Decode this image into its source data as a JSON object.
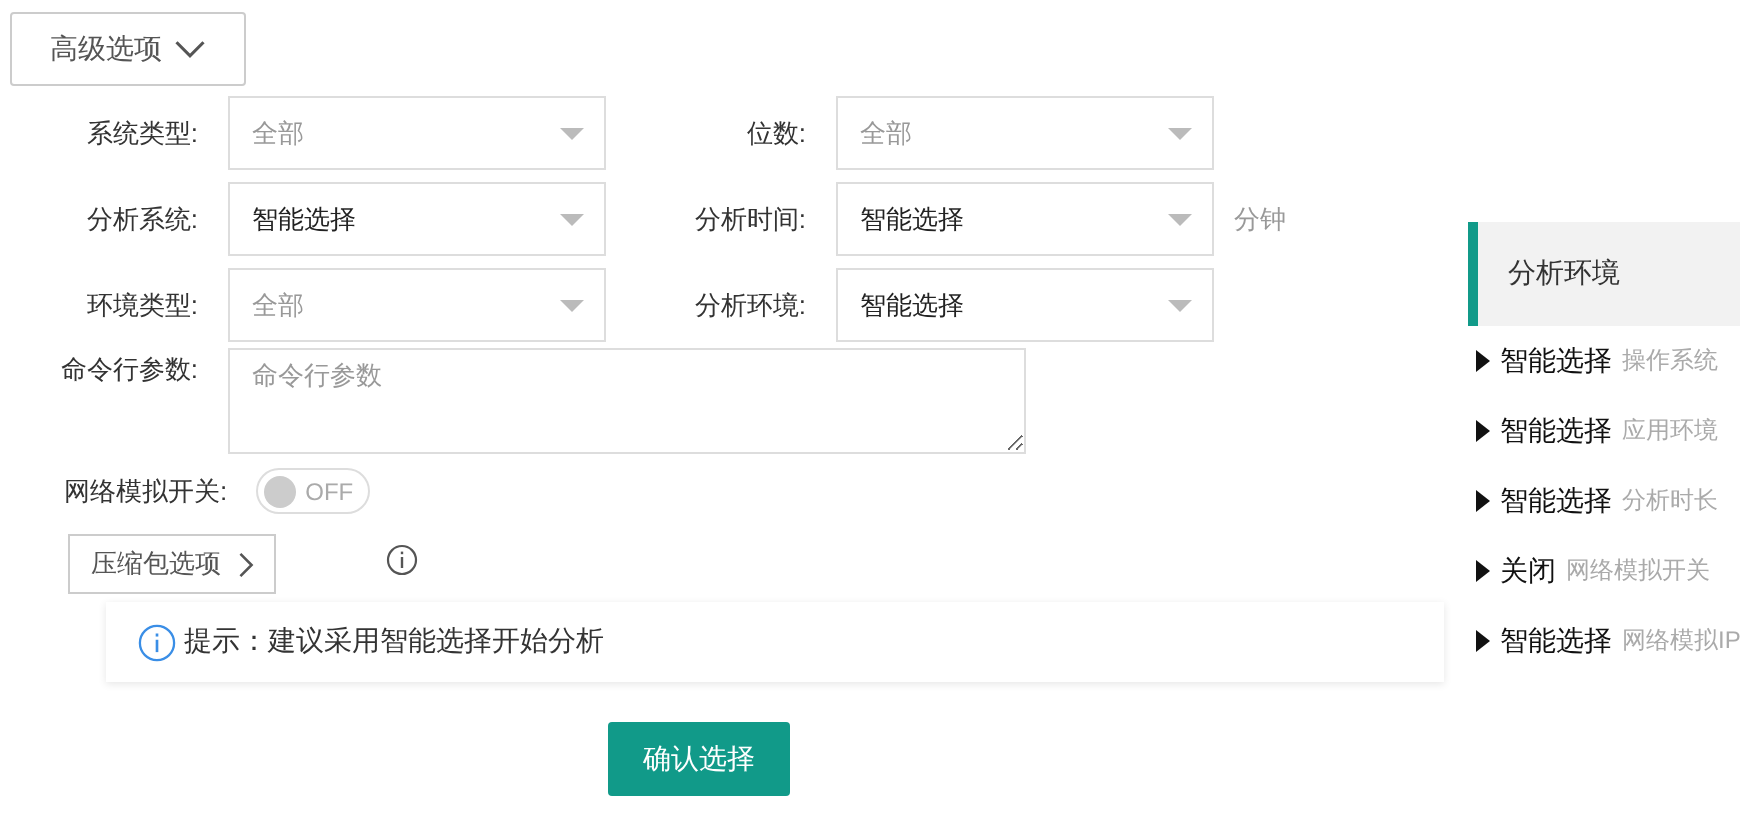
{
  "advanced_toggle": {
    "label": "高级选项",
    "expanded": true
  },
  "form_rows": [
    {
      "kind": "pair",
      "fields": [
        {
          "label": "系统类型:",
          "value": "全部",
          "muted": true
        },
        {
          "label": "位数:",
          "value": "全部",
          "muted": true
        }
      ]
    },
    {
      "kind": "pair",
      "fields": [
        {
          "label": "分析系统:",
          "value": "智能选择",
          "muted": false
        },
        {
          "label": "分析时间:",
          "value": "智能选择",
          "muted": false,
          "suffix": "分钟"
        }
      ]
    },
    {
      "kind": "pair",
      "fields": [
        {
          "label": "环境类型:",
          "value": "全部",
          "muted": true
        },
        {
          "label": "分析环境:",
          "value": "智能选择",
          "muted": false
        }
      ]
    }
  ],
  "command_line": {
    "label": "命令行参数:",
    "placeholder": "命令行参数"
  },
  "network_switch": {
    "label": "网络模拟开关:",
    "on": false,
    "text": "OFF"
  },
  "archive_options": {
    "label": "压缩包选项",
    "expanded": false
  },
  "tip": {
    "text": "提示：建议采用智能选择开始分析"
  },
  "confirm_button": "确认选择",
  "sidebar": {
    "title": "分析环境",
    "items": [
      {
        "value": "智能选择",
        "name": "操作系统"
      },
      {
        "value": "智能选择",
        "name": "应用环境"
      },
      {
        "value": "智能选择",
        "name": "分析时长"
      },
      {
        "value": "关闭",
        "name": "网络模拟开关"
      },
      {
        "value": "智能选择",
        "name": "网络模拟IP"
      }
    ]
  }
}
